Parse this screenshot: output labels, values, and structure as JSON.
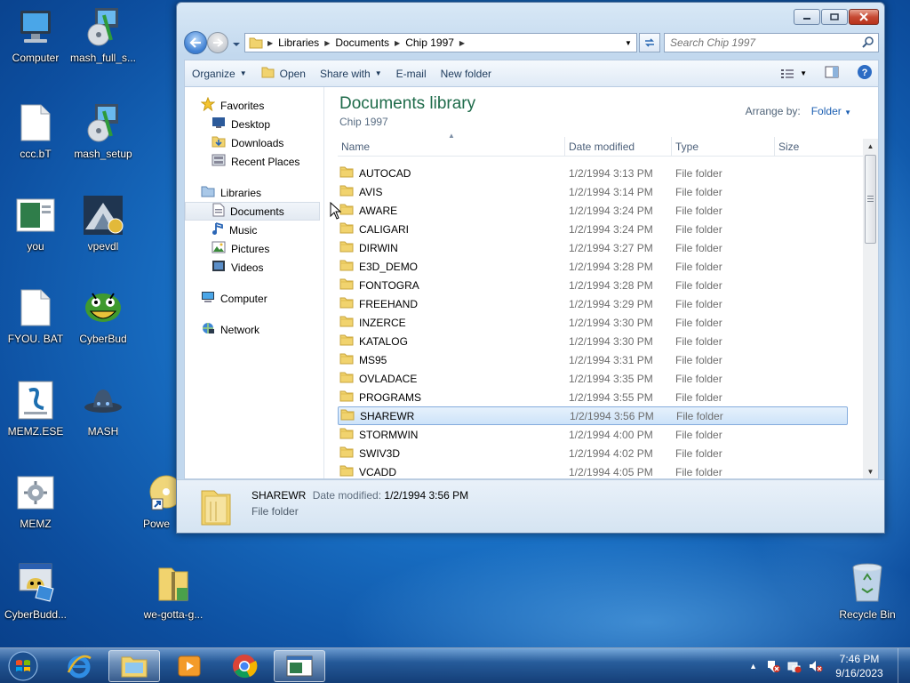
{
  "desktop": {
    "icons": [
      {
        "label": "Computer",
        "icon": "computer-icon"
      },
      {
        "label": "mash_full_s...",
        "icon": "installer-icon"
      },
      {
        "label": "ccc.bT",
        "icon": "file-icon"
      },
      {
        "label": "mash_setup",
        "icon": "installer-icon"
      },
      {
        "label": "you",
        "icon": "image-file-icon"
      },
      {
        "label": "vpevdl",
        "icon": "app-icon"
      },
      {
        "label": "FYOU. BAT",
        "icon": "file-icon"
      },
      {
        "label": "CyberBud",
        "icon": "cyberbud-icon"
      },
      {
        "label": "MEMZ.ESE",
        "icon": "script-icon"
      },
      {
        "label": "MASH",
        "icon": "hat-icon"
      },
      {
        "label": "MEMZ",
        "icon": "gear-file-icon"
      },
      {
        "label": "Powe",
        "icon": "dvd-icon"
      },
      {
        "label": "CyberBudd...",
        "icon": "setup-icon"
      },
      {
        "label": "we-gotta-g...",
        "icon": "zip-folder-icon"
      },
      {
        "label": "Recycle Bin",
        "icon": "recycle-bin-icon"
      }
    ]
  },
  "window": {
    "address": {
      "crumbs": [
        "Libraries",
        "Documents",
        "Chip 1997"
      ]
    },
    "search": {
      "placeholder": "Search Chip 1997"
    },
    "commands": {
      "organize": "Organize",
      "open": "Open",
      "share_with": "Share with",
      "email": "E-mail",
      "new_folder": "New folder"
    },
    "nav": {
      "favorites": "Favorites",
      "desktop": "Desktop",
      "downloads": "Downloads",
      "recent_places": "Recent Places",
      "libraries": "Libraries",
      "documents": "Documents",
      "music": "Music",
      "pictures": "Pictures",
      "videos": "Videos",
      "computer": "Computer",
      "network": "Network"
    },
    "library": {
      "title": "Documents library",
      "subtitle": "Chip 1997",
      "arrange_label": "Arrange by:",
      "arrange_value": "Folder"
    },
    "columns": {
      "name": "Name",
      "date": "Date modified",
      "type": "Type",
      "size": "Size"
    },
    "files": [
      {
        "name": "AUTOCAD",
        "date": "1/2/1994 3:13 PM",
        "type": "File folder"
      },
      {
        "name": "AVIS",
        "date": "1/2/1994 3:14 PM",
        "type": "File folder"
      },
      {
        "name": "AWARE",
        "date": "1/2/1994 3:24 PM",
        "type": "File folder"
      },
      {
        "name": "CALIGARI",
        "date": "1/2/1994 3:24 PM",
        "type": "File folder"
      },
      {
        "name": "DIRWIN",
        "date": "1/2/1994 3:27 PM",
        "type": "File folder"
      },
      {
        "name": "E3D_DEMO",
        "date": "1/2/1994 3:28 PM",
        "type": "File folder"
      },
      {
        "name": "FONTOGRA",
        "date": "1/2/1994 3:28 PM",
        "type": "File folder"
      },
      {
        "name": "FREEHAND",
        "date": "1/2/1994 3:29 PM",
        "type": "File folder"
      },
      {
        "name": "INZERCE",
        "date": "1/2/1994 3:30 PM",
        "type": "File folder"
      },
      {
        "name": "KATALOG",
        "date": "1/2/1994 3:30 PM",
        "type": "File folder"
      },
      {
        "name": "MS95",
        "date": "1/2/1994 3:31 PM",
        "type": "File folder"
      },
      {
        "name": "OVLADACE",
        "date": "1/2/1994 3:35 PM",
        "type": "File folder"
      },
      {
        "name": "PROGRAMS",
        "date": "1/2/1994 3:55 PM",
        "type": "File folder"
      },
      {
        "name": "SHAREWR",
        "date": "1/2/1994 3:56 PM",
        "type": "File folder",
        "selected": true
      },
      {
        "name": "STORMWIN",
        "date": "1/2/1994 4:00 PM",
        "type": "File folder"
      },
      {
        "name": "SWIV3D",
        "date": "1/2/1994 4:02 PM",
        "type": "File folder"
      },
      {
        "name": "VCADD",
        "date": "1/2/1994 4:05 PM",
        "type": "File folder"
      }
    ],
    "details": {
      "name": "SHAREWR",
      "modified_label": "Date modified:",
      "modified_value": "1/2/1994 3:56 PM",
      "type": "File folder"
    }
  },
  "taskbar": {
    "apps": [
      "internet-explorer-icon",
      "explorer-folder-icon",
      "media-player-icon",
      "chrome-icon",
      "window-app-icon"
    ],
    "clock": {
      "time": "7:46 PM",
      "date": "9/16/2023"
    }
  },
  "colors": {
    "accent": "#1c5fb2",
    "library_title": "#1e6b4a",
    "selection": "#cde3f9"
  }
}
